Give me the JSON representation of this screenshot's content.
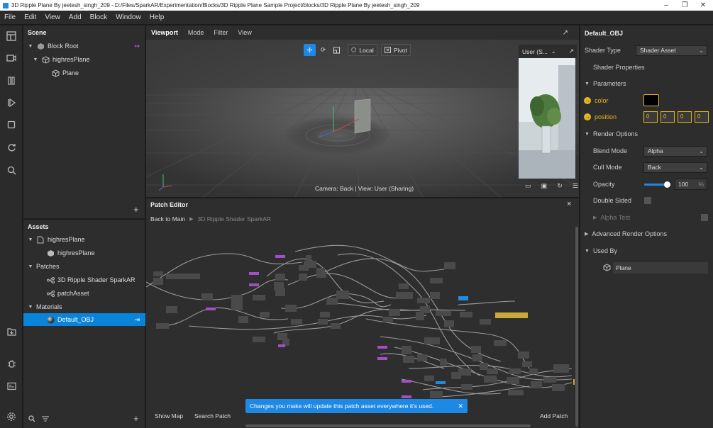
{
  "window": {
    "title": "3D Ripple Plane By jeetesh_singh_209 - D:/Files/SparkAR/Experimentation/Blocks/3D Ripple Plane Sample Project/blocks/3D Ripple Plane By jeetesh_singh_209"
  },
  "menu": [
    "File",
    "Edit",
    "View",
    "Add",
    "Block",
    "Window",
    "Help"
  ],
  "scene": {
    "title": "Scene",
    "items": [
      {
        "label": "Block Root"
      },
      {
        "label": "highresPlane"
      },
      {
        "label": "Plane"
      }
    ]
  },
  "assets": {
    "title": "Assets",
    "items": [
      {
        "label": "highresPlane"
      },
      {
        "label": "highresPlane"
      },
      {
        "label": "Patches"
      },
      {
        "label": "3D Ripple Shader SparkAR"
      },
      {
        "label": "patchAsset"
      },
      {
        "label": "Materials"
      },
      {
        "label": "Default_OBJ"
      }
    ]
  },
  "viewport": {
    "tabs": [
      "Viewport",
      "Mode",
      "Filter",
      "View"
    ],
    "toolbar": {
      "local": "Local",
      "pivot": "Pivot"
    },
    "camera_select": "User (S...",
    "status": "Camera: Back | View: User (Sharing)"
  },
  "patch_editor": {
    "title": "Patch Editor",
    "breadcrumb": [
      "Back to Main",
      "3D Ripple Shader SparkAR"
    ],
    "toast": "Changes you make will update this patch asset everywhere it's used.",
    "bottom": {
      "show_map": "Show Map",
      "search_patch": "Search Patch",
      "add_patch": "Add Patch"
    }
  },
  "inspector": {
    "title": "Default_OBJ",
    "shader_type_label": "Shader Type",
    "shader_type_value": "Shader Asset",
    "shader_properties": "Shader Properties",
    "parameters": "Parameters",
    "color_label": "color",
    "position_label": "position",
    "position_values": [
      "0",
      "0",
      "0",
      "0"
    ],
    "render_options": "Render Options",
    "blend_mode_label": "Blend Mode",
    "blend_mode_value": "Alpha",
    "cull_mode_label": "Cull Mode",
    "cull_mode_value": "Back",
    "opacity_label": "Opacity",
    "opacity_value": "100",
    "opacity_unit": "%",
    "opacity_fraction": 1.0,
    "double_sided_label": "Double Sided",
    "alpha_test_label": "Alpha Test",
    "advanced_render_options": "Advanced Render Options",
    "used_by": "Used By",
    "used_by_item": "Plane"
  },
  "colors": {
    "accent": "#1e88e5",
    "selection": "#0a84d8",
    "param_yellow": "#e6b422",
    "node_purple": "#a24fc6",
    "node_blue": "#1c8de0",
    "node_gold": "#c9a93b"
  }
}
